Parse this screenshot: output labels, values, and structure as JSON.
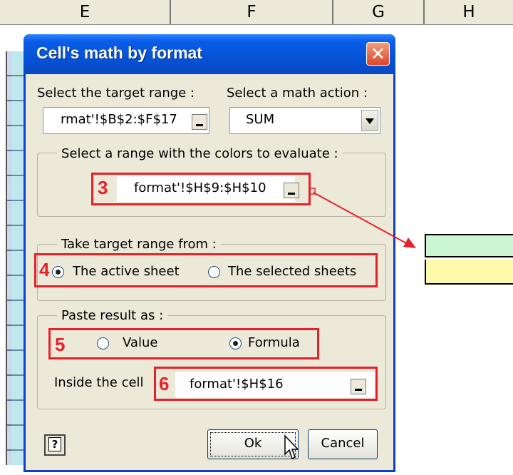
{
  "spreadsheet": {
    "columns": [
      "E",
      "F",
      "G",
      "H"
    ]
  },
  "dialog": {
    "title": "Cell's math by format",
    "target_range_label": "Select the target range :",
    "target_range_value": "rmat'!$B$2:$F$17",
    "math_action_label": "Select a math action :",
    "math_action_value": "SUM",
    "colors_group_title": "Select a range with the colors to evaluate :",
    "colors_range_value": "format'!$H$9:$H$10",
    "take_from_group_title": "Take target range from :",
    "take_from_options": [
      "The active sheet",
      "The selected sheets"
    ],
    "take_from_selected": "The active sheet",
    "paste_group_title": "Paste result as :",
    "paste_options": [
      "Value",
      "Formula"
    ],
    "paste_selected": "Formula",
    "inside_cell_label": "Inside the cell",
    "inside_cell_value": "format'!$H$16",
    "ok_label": "Ok",
    "cancel_label": "Cancel",
    "help_label": "?"
  },
  "annotations": {
    "markers": [
      "3",
      "4",
      "5",
      "6"
    ],
    "color": "#e8202a"
  },
  "colors": {
    "title_bar": "#0553d6",
    "dialog_bg": "#ece9d8",
    "swatch_green": "#ccf5d3",
    "swatch_yellow": "#fffaaa"
  }
}
